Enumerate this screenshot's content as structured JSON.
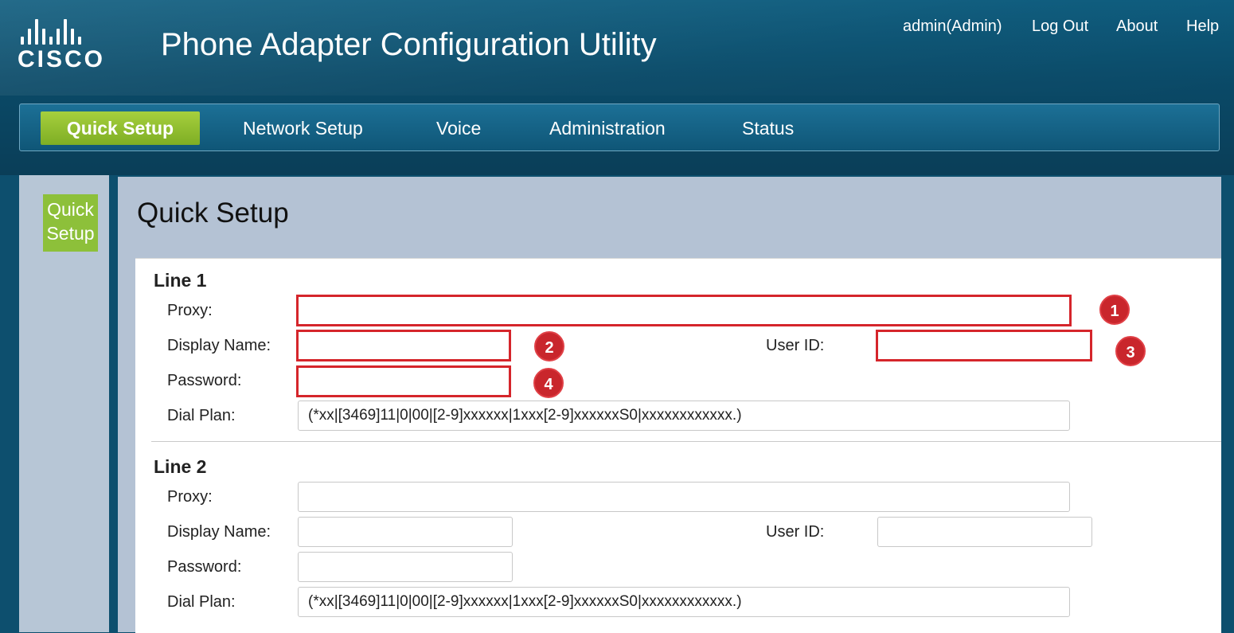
{
  "header": {
    "logo_text": "CISCO",
    "title": "Phone Adapter Configuration Utility",
    "user_label": "admin(Admin)",
    "logout_label": "Log Out",
    "about_label": "About",
    "help_label": "Help"
  },
  "nav": {
    "tabs": [
      {
        "label": "Quick Setup",
        "active": true
      },
      {
        "label": "Network Setup",
        "active": false
      },
      {
        "label": "Voice",
        "active": false
      },
      {
        "label": "Administration",
        "active": false
      },
      {
        "label": "Status",
        "active": false
      }
    ]
  },
  "sidebar": {
    "items": [
      {
        "label_line1": "Quick",
        "label_line2": "Setup",
        "active": true
      }
    ]
  },
  "page": {
    "title": "Quick Setup"
  },
  "line1": {
    "heading": "Line 1",
    "proxy_label": "Proxy:",
    "proxy_value": "",
    "display_name_label": "Display Name:",
    "display_name_value": "",
    "user_id_label": "User ID:",
    "user_id_value": "",
    "password_label": "Password:",
    "password_value": "",
    "dial_plan_label": "Dial Plan:",
    "dial_plan_value": "(*xx|[3469]11|0|00|[2-9]xxxxxx|1xxx[2-9]xxxxxxS0|xxxxxxxxxxxx.)"
  },
  "line2": {
    "heading": "Line 2",
    "proxy_label": "Proxy:",
    "proxy_value": "",
    "display_name_label": "Display Name:",
    "display_name_value": "",
    "user_id_label": "User ID:",
    "user_id_value": "",
    "password_label": "Password:",
    "password_value": "",
    "dial_plan_label": "Dial Plan:",
    "dial_plan_value": "(*xx|[3469]11|0|00|[2-9]xxxxxx|1xxx[2-9]xxxxxxS0|xxxxxxxxxxxx.)"
  },
  "annotations": [
    "1",
    "2",
    "3",
    "4"
  ],
  "colors": {
    "header_bg": "#0a4a68",
    "active_tab": "#8dc03a",
    "highlight_border": "#d5252b",
    "badge": "#c9262c"
  }
}
